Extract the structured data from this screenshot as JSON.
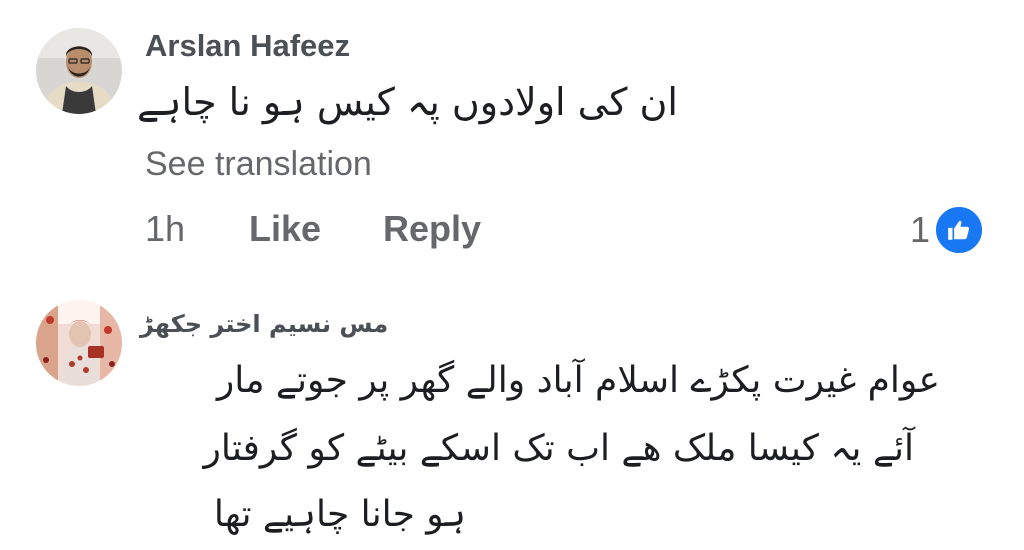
{
  "comments": [
    {
      "author": "Arslan Hafeez",
      "text": "ان کی اولادوں پہ کیس ہو نا چاہے",
      "see_translation": "See translation",
      "time": "1h",
      "like_label": "Like",
      "reply_label": "Reply",
      "reaction_count": "1",
      "reaction_icon": "thumbs-up-icon"
    },
    {
      "author": "مس نسیم اختر جکھڑ",
      "text_lines": [
        "عوام غیرت پکڑے اسلام آباد والے گھر پر جوتے مار",
        "آئے یہ کیسا ملک ھے اب تک اسکے بیٹے کو گرفتار",
        "ہو جانا چاہیے تھا"
      ]
    }
  ],
  "colors": {
    "like_blue": "#1877f2",
    "meta_gray": "#65676b",
    "text": "#1c1e21"
  }
}
